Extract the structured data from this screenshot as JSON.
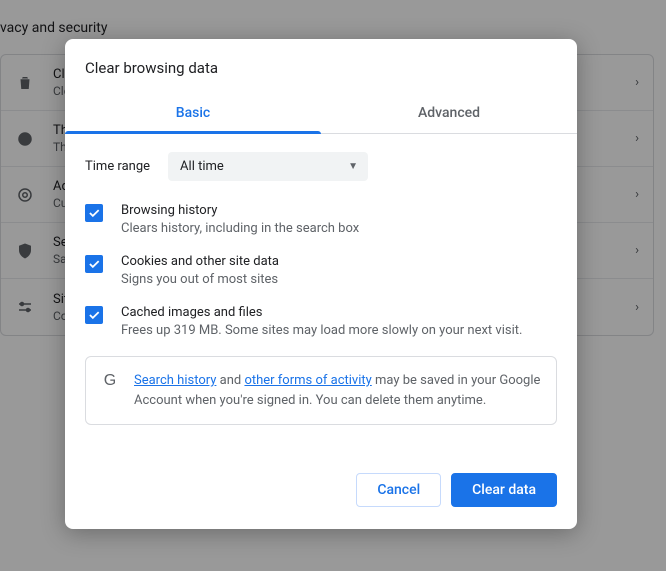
{
  "background": {
    "heading": "vacy and security",
    "rows": [
      {
        "title": "Clear",
        "sub": "Clear"
      },
      {
        "title": "Third",
        "sub": "Third"
      },
      {
        "title": "Ad p",
        "sub": "Custo"
      },
      {
        "title": "Secu",
        "sub": "Safe"
      },
      {
        "title": "Site s",
        "sub": "Cont"
      }
    ]
  },
  "dialog": {
    "title": "Clear browsing data",
    "tabs": {
      "basic": "Basic",
      "advanced": "Advanced"
    },
    "time_range": {
      "label": "Time range",
      "value": "All time"
    },
    "items": [
      {
        "checked": true,
        "primary": "Browsing history",
        "secondary": "Clears history, including in the search box"
      },
      {
        "checked": true,
        "primary": "Cookies and other site data",
        "secondary": "Signs you out of most sites"
      },
      {
        "checked": true,
        "primary": "Cached images and files",
        "secondary": "Frees up 319 MB. Some sites may load more slowly on your next visit."
      }
    ],
    "notice": {
      "link1": "Search history",
      "mid1": " and ",
      "link2": "other forms of activity",
      "rest": " may be saved in your Google Account when you're signed in. You can delete them anytime."
    },
    "actions": {
      "cancel": "Cancel",
      "clear": "Clear data"
    }
  }
}
